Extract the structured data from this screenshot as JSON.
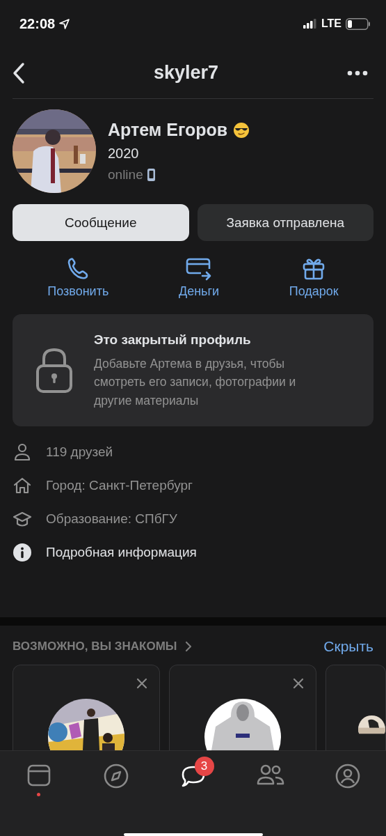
{
  "status_bar": {
    "time": "22:08",
    "network": "LTE"
  },
  "header": {
    "title": "skyler7"
  },
  "profile": {
    "name": "Артем Егоров",
    "year": "2020",
    "status": "online"
  },
  "buttons": [
    {
      "label": "Сообщение",
      "kind": "primary"
    },
    {
      "label": "Заявка отправлена",
      "kind": "secondary"
    }
  ],
  "actions": [
    {
      "label": "Позвонить",
      "kind": "call"
    },
    {
      "label": "Деньги",
      "kind": "money"
    },
    {
      "label": "Подарок",
      "kind": "gift"
    }
  ],
  "locked_profile": {
    "title": "Это закрытый профиль",
    "text": "Добавьте Артема в друзья, чтобы смотреть его записи, фотографии и другие материалы"
  },
  "info": [
    {
      "text": "119 друзей",
      "kind": "friends",
      "highlighted": false
    },
    {
      "text": "Город: Санкт-Петербург",
      "kind": "city",
      "highlighted": false
    },
    {
      "text": "Образование: СПбГУ",
      "kind": "education",
      "highlighted": false
    },
    {
      "text": "Подробная информация",
      "kind": "details",
      "highlighted": true
    }
  ],
  "suggestions": {
    "title": "ВОЗМОЖНО, ВЫ ЗНАКОМЫ",
    "action": "Скрыть"
  },
  "tab_bar": [
    {
      "kind": "feed",
      "selected": false,
      "dot": true
    },
    {
      "kind": "explore",
      "selected": false,
      "dot": false
    },
    {
      "kind": "messages",
      "selected": true,
      "dot": false,
      "badge": "3"
    },
    {
      "kind": "friends",
      "selected": false,
      "dot": false
    },
    {
      "kind": "profile",
      "selected": false,
      "dot": false
    }
  ]
}
